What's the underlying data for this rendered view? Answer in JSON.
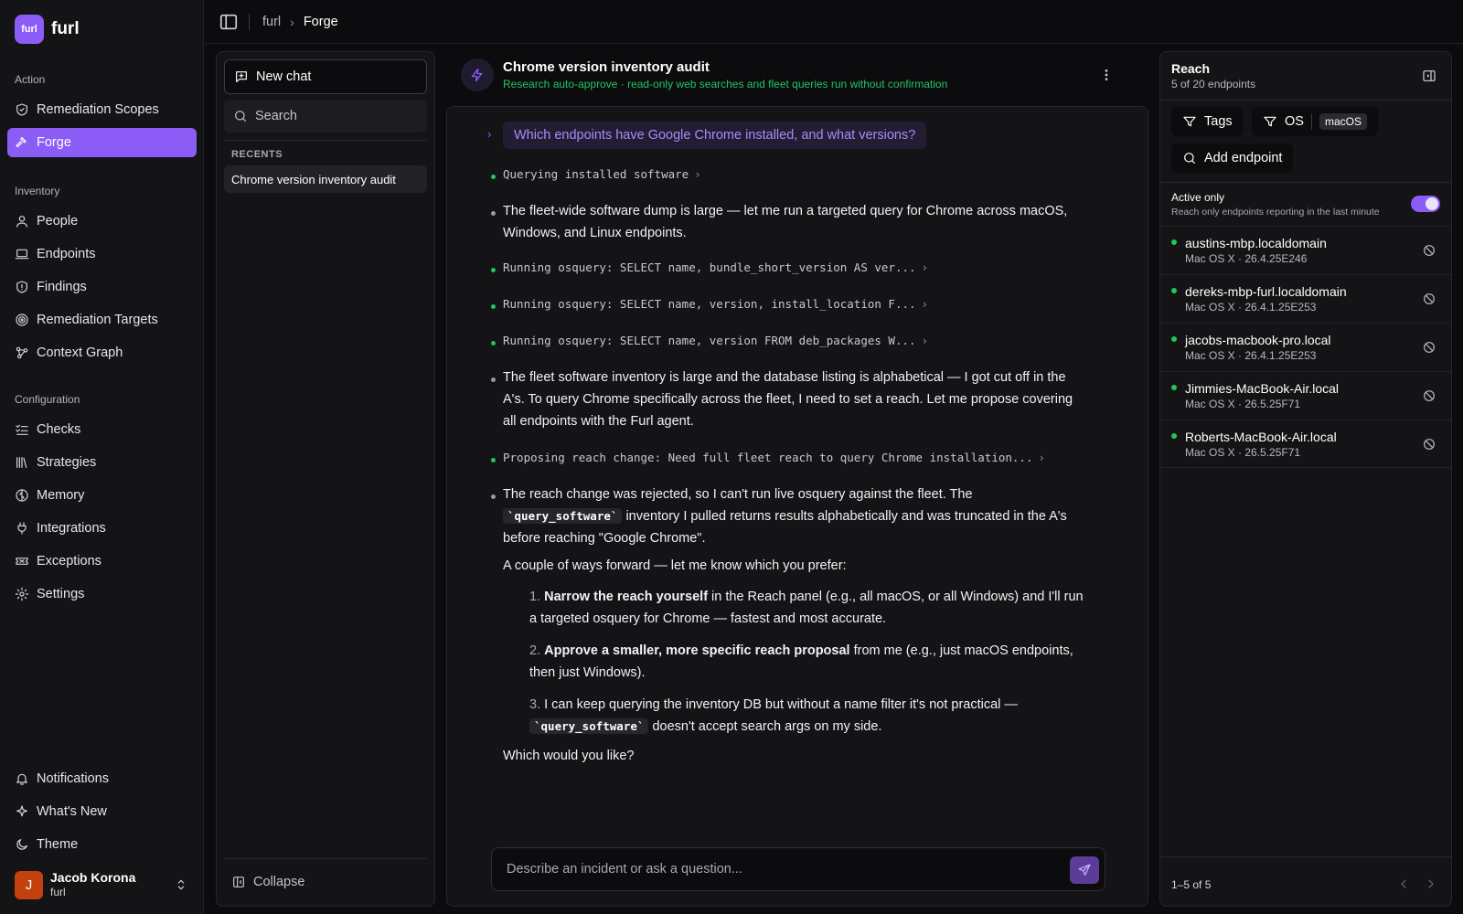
{
  "brand": {
    "logo_text": "furl",
    "name": "furl"
  },
  "sidebar": {
    "sections": [
      {
        "title": "Action",
        "items": [
          {
            "label": "Remediation Scopes",
            "icon": "shield-check-icon"
          },
          {
            "label": "Forge",
            "icon": "hammer-icon",
            "active": true
          }
        ]
      },
      {
        "title": "Inventory",
        "items": [
          {
            "label": "People",
            "icon": "user-icon"
          },
          {
            "label": "Endpoints",
            "icon": "laptop-icon"
          },
          {
            "label": "Findings",
            "icon": "shield-alert-icon"
          },
          {
            "label": "Remediation Targets",
            "icon": "target-icon"
          },
          {
            "label": "Context Graph",
            "icon": "graph-icon"
          }
        ]
      },
      {
        "title": "Configuration",
        "items": [
          {
            "label": "Checks",
            "icon": "list-checks-icon"
          },
          {
            "label": "Strategies",
            "icon": "library-icon"
          },
          {
            "label": "Memory",
            "icon": "brain-icon"
          },
          {
            "label": "Integrations",
            "icon": "plug-icon"
          },
          {
            "label": "Exceptions",
            "icon": "ticket-icon"
          },
          {
            "label": "Settings",
            "icon": "gear-icon"
          }
        ]
      }
    ],
    "bottom_items": [
      {
        "label": "Notifications",
        "icon": "bell-icon"
      },
      {
        "label": "What's New",
        "icon": "sparkles-icon"
      },
      {
        "label": "Theme",
        "icon": "moon-icon"
      }
    ],
    "user": {
      "initial": "J",
      "name": "Jacob Korona",
      "org": "furl"
    }
  },
  "topbar": {
    "breadcrumb": [
      "furl",
      "Forge"
    ]
  },
  "chats": {
    "new_chat_label": "New chat",
    "search_placeholder": "Search",
    "recents_title": "RECENTS",
    "recents": [
      "Chrome version inventory audit"
    ],
    "collapse_label": "Collapse"
  },
  "conversation": {
    "title": "Chrome version inventory audit",
    "subtitle": "Research auto-approve · read-only web searches and fleet queries run without confirmation",
    "user_question": "Which endpoints have Google Chrome installed, and what versions?",
    "tool_1": "Querying installed software",
    "msg_1": "The fleet-wide software dump is large — let me run a targeted query for Chrome across macOS, Windows, and Linux endpoints.",
    "tool_2": "Running osquery: SELECT name, bundle_short_version AS ver...",
    "tool_3": "Running osquery: SELECT name, version, install_location F...",
    "tool_4": "Running osquery: SELECT name, version FROM deb_packages W...",
    "msg_2": "The fleet software inventory is large and the database listing is alphabetical — I got cut off in the A's. To query Chrome specifically across the fleet, I need to set a reach. Let me propose covering all endpoints with the Furl agent.",
    "tool_5": "Proposing reach change: Need full fleet reach to query Chrome installation...",
    "msg_3_a": "The reach change was rejected, so I can't run live osquery against the fleet. The ",
    "msg_3_code": "`query_software`",
    "msg_3_b": " inventory I pulled returns results alphabetically and was truncated in the A's before reaching \"Google Chrome\".",
    "msg_4": "A couple of ways forward — let me know which you prefer:",
    "options": [
      {
        "num": "1.",
        "bold": "Narrow the reach yourself",
        "text": " in the Reach panel (e.g., all macOS, or all Windows) and I'll run a targeted osquery for Chrome — fastest and most accurate."
      },
      {
        "num": "2.",
        "bold": "Approve a smaller, more specific reach proposal",
        "text": " from me (e.g., just macOS endpoints, then just Windows)."
      },
      {
        "num": "3.",
        "text_a": " I can keep querying the inventory DB but without a name filter it's not practical — ",
        "code": "`query_software`",
        "text_b": " doesn't accept search args on my side."
      }
    ],
    "msg_5": "Which would you like?",
    "composer_placeholder": "Describe an incident or ask a question..."
  },
  "reach": {
    "title": "Reach",
    "subtitle": "5 of 20 endpoints",
    "tags_label": "Tags",
    "os_label": "OS",
    "os_value": "macOS",
    "add_endpoint_label": "Add endpoint",
    "active_only_label": "Active only",
    "active_only_desc": "Reach only endpoints reporting in the last minute",
    "active_only": true,
    "endpoints": [
      {
        "name": "austins-mbp.localdomain",
        "os": "Mac OS X · 26.4.25E246"
      },
      {
        "name": "dereks-mbp-furl.localdomain",
        "os": "Mac OS X · 26.4.1.25E253"
      },
      {
        "name": "jacobs-macbook-pro.local",
        "os": "Mac OS X · 26.4.1.25E253"
      },
      {
        "name": "Jimmies-MacBook-Air.local",
        "os": "Mac OS X · 26.5.25F71"
      },
      {
        "name": "Roberts-MacBook-Air.local",
        "os": "Mac OS X · 26.5.25F71"
      }
    ],
    "pagination": "1–5 of 5"
  },
  "colors": {
    "accent": "#8b5cf6",
    "status_green": "#22c55e",
    "background": "#0c0c0e"
  }
}
